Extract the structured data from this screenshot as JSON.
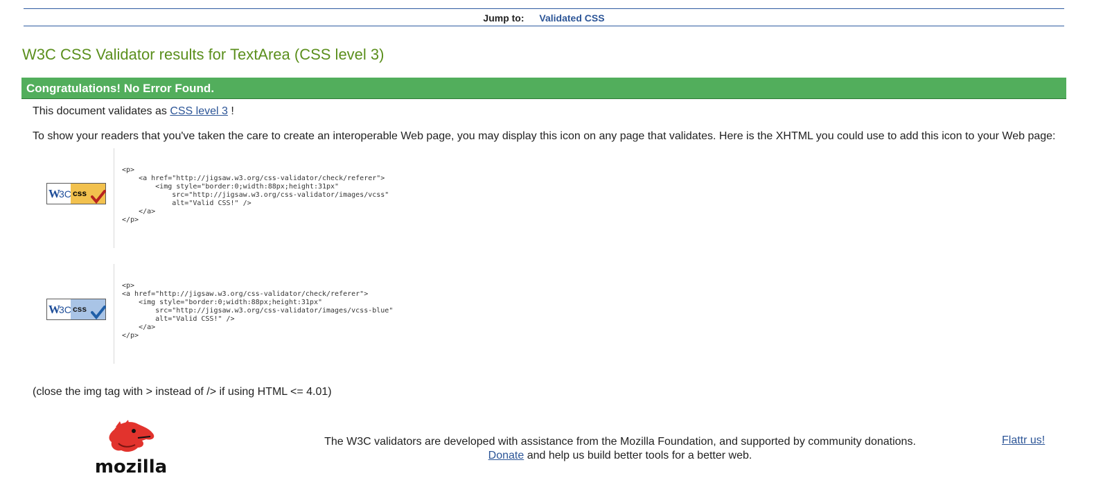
{
  "jumpbar": {
    "label": "Jump to:",
    "link": "Validated CSS"
  },
  "title": "W3C CSS Validator results for TextArea (CSS level 3)",
  "congrats": "Congratulations! No Error Found.",
  "validates": {
    "prefix": "This document validates as",
    "link": "CSS level 3",
    "suffix": "!"
  },
  "info_text": "To show your readers that you've taken the care to create an interoperable Web page, you may display this icon on any page that validates. Here is the XHTML you could use to add this icon to your Web page:",
  "badges": [
    {
      "badge_text": "W3C css",
      "code": "<p>\n    <a href=\"http://jigsaw.w3.org/css-validator/check/referer\">\n        <img style=\"border:0;width:88px;height:31px\"\n            src=\"http://jigsaw.w3.org/css-validator/images/vcss\"\n            alt=\"Valid CSS!\" />\n    </a>\n</p>",
      "accent": "#f2c14e"
    },
    {
      "badge_text": "W3C css",
      "code": "<p>\n<a href=\"http://jigsaw.w3.org/css-validator/check/referer\">\n    <img style=\"border:0;width:88px;height:31px\"\n        src=\"http://jigsaw.w3.org/css-validator/images/vcss-blue\"\n        alt=\"Valid CSS!\" />\n    </a>\n</p>",
      "accent": "#a9c4e6"
    }
  ],
  "close_note": "(close the img tag with > instead of /> if using HTML <= 4.01)",
  "footer": {
    "logo_text": "mozilla",
    "line1": "The W3C validators are developed with assistance from the Mozilla Foundation, and supported by community donations.",
    "donate_link": "Donate",
    "line2_rest": "and help us build better tools for a better web.",
    "flattr": "Flattr us!"
  },
  "colors": {
    "title_green": "#5b8f1d",
    "congrats_bg": "#52ae5c",
    "link_blue": "#2c5597",
    "nav_rule": "#2d5aa0"
  }
}
